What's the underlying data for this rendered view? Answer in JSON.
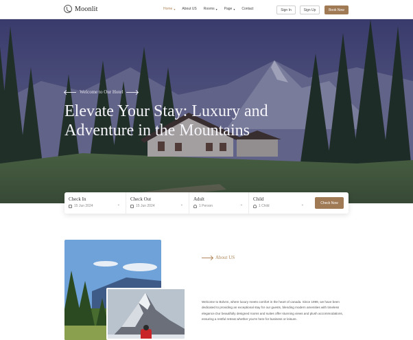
{
  "header": {
    "logo_text": "Moonlit",
    "nav": [
      {
        "label": "Home",
        "caret": true,
        "active": true
      },
      {
        "label": "About US",
        "caret": false,
        "active": false
      },
      {
        "label": "Rooms",
        "caret": true,
        "active": false
      },
      {
        "label": "Page",
        "caret": true,
        "active": false
      },
      {
        "label": "Contact",
        "caret": false,
        "active": false
      }
    ],
    "sign_in": "Sign In",
    "sign_up": "Sign Up",
    "book_now": "Book Now"
  },
  "hero": {
    "eyebrow": "Welcome to Our Hotel",
    "title": "Elevate Your Stay: Luxury and Adventure in the Mountains"
  },
  "booking": {
    "check_in_label": "Check In",
    "check_in_value": "15 Jun 2024",
    "check_out_label": "Check Out",
    "check_out_value": "15 Jun 2024",
    "adult_label": "Adult",
    "adult_value": "1 Person",
    "child_label": "Child",
    "child_value": "1 Child",
    "check_now": "Check Now"
  },
  "about": {
    "eyebrow": "About US",
    "text": "Welcome to Bolvnn, where luxury meets comfort in the heart of canada. Since 1999, we have been dedicated to providing an exceptional stay for our guests, blending modern amenities with timeless elegance.Our beautifully designed rooms and suites offer stunning views and plush accommodations, ensuring a restful retreat whether you're here for business or leisure."
  },
  "colors": {
    "accent": "#a07a55",
    "accent_text": "#b0865a",
    "hero_overlay": "#3c3e6e"
  },
  "icons": {
    "logo": "moon-logo-icon",
    "calendar": "calendar-icon",
    "user": "user-icon",
    "chevron": "chevron-down-icon",
    "arrow_left": "arrow-left-icon",
    "arrow_right": "arrow-right-icon"
  }
}
